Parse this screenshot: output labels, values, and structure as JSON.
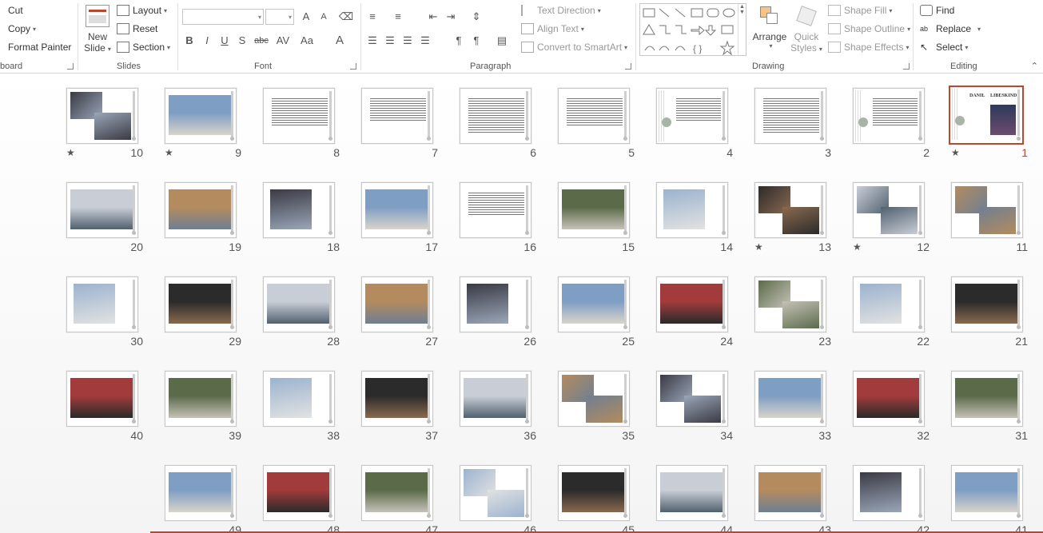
{
  "ribbon": {
    "clipboard": {
      "cut": "Cut",
      "copy": "Copy",
      "format_painter": "Format Painter",
      "label": "board"
    },
    "slides": {
      "new_slide_1": "New",
      "new_slide_2": "Slide",
      "layout": "Layout",
      "reset": "Reset",
      "section": "Section",
      "label": "Slides"
    },
    "font": {
      "label": "Font",
      "bold": "B",
      "italic": "I",
      "underline": "U",
      "shadow": "S",
      "strike": "abc",
      "spacing": "AV",
      "case": "Aa",
      "color": "A",
      "grow": "A",
      "shrink": "A"
    },
    "paragraph": {
      "label": "Paragraph",
      "text_direction": "Text Direction",
      "align_text": "Align Text",
      "convert_smartart": "Convert to SmartArt"
    },
    "drawing": {
      "label": "Drawing",
      "arrange": "Arrange",
      "quick_styles_1": "Quick",
      "quick_styles_2": "Styles",
      "shape_fill": "Shape Fill",
      "shape_outline": "Shape Outline",
      "shape_effects": "Shape Effects"
    },
    "editing": {
      "label": "Editing",
      "find": "Find",
      "replace": "Replace",
      "select": "Select"
    }
  },
  "slides": [
    {
      "n": "1",
      "star": true,
      "selected": true,
      "kind": "title",
      "title_left": "DANIL",
      "title_right": "LIBESKIND"
    },
    {
      "n": "2",
      "star": false,
      "kind": "textdeco"
    },
    {
      "n": "3",
      "star": false,
      "kind": "text"
    },
    {
      "n": "4",
      "star": false,
      "kind": "textdeco"
    },
    {
      "n": "5",
      "star": false,
      "kind": "text"
    },
    {
      "n": "6",
      "star": false,
      "kind": "text"
    },
    {
      "n": "7",
      "star": false,
      "kind": "text"
    },
    {
      "n": "8",
      "star": false,
      "kind": "text"
    },
    {
      "n": "9",
      "star": true,
      "kind": "photo"
    },
    {
      "n": "10",
      "star": true,
      "kind": "photo2"
    },
    {
      "n": "11",
      "star": false,
      "kind": "photo2"
    },
    {
      "n": "12",
      "star": true,
      "kind": "photo2"
    },
    {
      "n": "13",
      "star": true,
      "kind": "photo2"
    },
    {
      "n": "14",
      "star": false,
      "kind": "photo"
    },
    {
      "n": "15",
      "star": false,
      "kind": "photo"
    },
    {
      "n": "16",
      "star": false,
      "kind": "text"
    },
    {
      "n": "17",
      "star": false,
      "kind": "photo"
    },
    {
      "n": "18",
      "star": false,
      "kind": "photo"
    },
    {
      "n": "19",
      "star": false,
      "kind": "photo"
    },
    {
      "n": "20",
      "star": false,
      "kind": "photo"
    },
    {
      "n": "21",
      "star": false,
      "kind": "photo"
    },
    {
      "n": "22",
      "star": false,
      "kind": "photo"
    },
    {
      "n": "23",
      "star": false,
      "kind": "photo2"
    },
    {
      "n": "24",
      "star": false,
      "kind": "photo"
    },
    {
      "n": "25",
      "star": false,
      "kind": "photo"
    },
    {
      "n": "26",
      "star": false,
      "kind": "photo"
    },
    {
      "n": "27",
      "star": false,
      "kind": "photo"
    },
    {
      "n": "28",
      "star": false,
      "kind": "photo"
    },
    {
      "n": "29",
      "star": false,
      "kind": "photo"
    },
    {
      "n": "30",
      "star": false,
      "kind": "photo"
    },
    {
      "n": "31",
      "star": false,
      "kind": "photo"
    },
    {
      "n": "32",
      "star": false,
      "kind": "photo"
    },
    {
      "n": "33",
      "star": false,
      "kind": "photo"
    },
    {
      "n": "34",
      "star": false,
      "kind": "photo2"
    },
    {
      "n": "35",
      "star": false,
      "kind": "photo2"
    },
    {
      "n": "36",
      "star": false,
      "kind": "photo"
    },
    {
      "n": "37",
      "star": false,
      "kind": "photo"
    },
    {
      "n": "38",
      "star": false,
      "kind": "photo"
    },
    {
      "n": "39",
      "star": false,
      "kind": "photo"
    },
    {
      "n": "40",
      "star": false,
      "kind": "photo"
    },
    {
      "n": "41",
      "star": false,
      "kind": "photo"
    },
    {
      "n": "42",
      "star": false,
      "kind": "photo"
    },
    {
      "n": "43",
      "star": false,
      "kind": "photo"
    },
    {
      "n": "44",
      "star": false,
      "kind": "photo"
    },
    {
      "n": "45",
      "star": false,
      "kind": "photo"
    },
    {
      "n": "46",
      "star": false,
      "kind": "photo2"
    },
    {
      "n": "47",
      "star": false,
      "kind": "photo"
    },
    {
      "n": "48",
      "star": false,
      "kind": "photo"
    },
    {
      "n": "49",
      "star": false,
      "kind": "photo"
    }
  ],
  "colors": {
    "accent": "#c0452a",
    "photo_sky": "#7f9ec4",
    "photo_dark": "#2b2b2b",
    "photo_warm": "#b38b5e"
  }
}
